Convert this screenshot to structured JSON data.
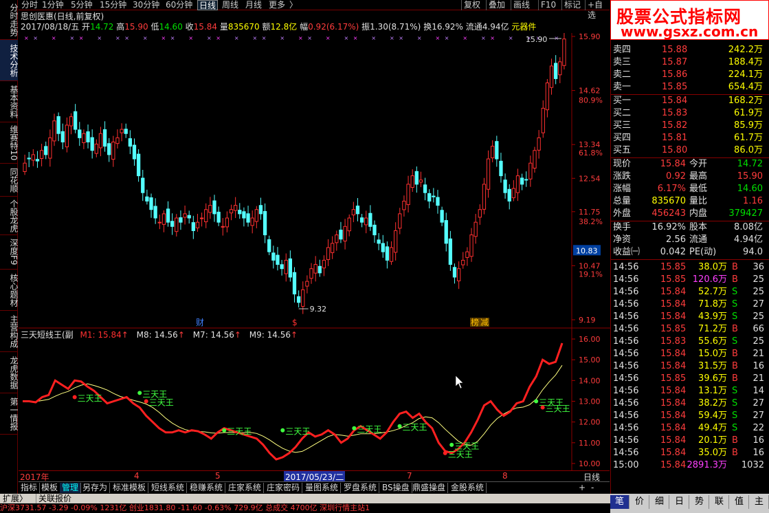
{
  "left_tabs": [
    "分时走势",
    "技术分析",
    "基本资料",
    "维赛特10",
    "同花顺",
    "个股龙虎",
    "深度F9",
    "核心题材",
    "主营构成",
    "龙虎数据",
    "第一情报"
  ],
  "period_bar": {
    "items": [
      "分时",
      "1分钟",
      "5分钟",
      "15分钟",
      "30分钟",
      "60分钟",
      "日线",
      "周线",
      "月线",
      "更多"
    ],
    "active": "日线",
    "more_arrow": "〉",
    "right_buttons": [
      "复权",
      "叠加",
      "画线",
      "F10",
      "标记",
      "+自选"
    ]
  },
  "watermark": {
    "title": "股票公式指标网",
    "url": "www.gsxz.com.cn"
  },
  "main_chart": {
    "stock_title": "思创医惠(日线,前复权)",
    "info": {
      "date": "2017/08/18/五",
      "open_label": "开",
      "open": "14.72",
      "high_label": "高",
      "high": "15.90",
      "low_label": "低",
      "low": "14.60",
      "close_label": "收",
      "close": "15.84",
      "vol_label": "量",
      "vol": "835670",
      "amt_label": "额",
      "amt": "12.8亿",
      "chg_label": "幅",
      "chg": "0.92(6.17%)",
      "amp_label": "振",
      "amp": "1.30(8.71%)",
      "turn_label": "换",
      "turn": "16.92%",
      "float_label": "流通",
      "float": "4.94亿",
      "tag": "元器件"
    },
    "price_labels": [
      "15.90",
      "14.62",
      "80.9%",
      "13.34",
      "61.8%",
      "12.54",
      "11.75",
      "38.2%",
      "10.47",
      "19.1%",
      "9.19"
    ],
    "current_price_box": "10.83",
    "annotations": {
      "high": "15.90",
      "low": "9.32"
    },
    "event_markers": [
      {
        "text": "财",
        "color": "#4080ff"
      },
      {
        "text": "$",
        "color": "#ff3030"
      },
      {
        "text": "榜",
        "color": "#ffc000"
      },
      {
        "text": "减",
        "color": "#ffc000"
      }
    ]
  },
  "indicator": {
    "name": "三天短线王(副",
    "lines": [
      {
        "label": "M1: 15.84",
        "color": "#ff3030"
      },
      {
        "label": "M8: 14.56",
        "color": "#ffffff"
      },
      {
        "label": "M7: 14.56",
        "color": "#ffffff"
      },
      {
        "label": "M9: 14.56",
        "color": "#ffffff"
      }
    ],
    "axis_labels": [
      "16.00",
      "15.00",
      "14.00",
      "13.00",
      "12.00",
      "11.00",
      "10.00"
    ],
    "signal_label": "三天王"
  },
  "time_axis": {
    "labels": [
      "2017年",
      "4",
      "5",
      "6",
      "7",
      "8"
    ],
    "highlight": "2017/05/23/二",
    "period": "日线"
  },
  "bottom_tabs": [
    "指标",
    "模板",
    "管理",
    "另存为",
    "标准模板",
    "短线系统",
    "稳赚系统",
    "庄家系统",
    "庄家密码",
    "量图系统",
    "罗盘系统",
    "BS操盘",
    "鼎盛操盘",
    "金股系统"
  ],
  "bottom_tabs_active": "管理",
  "expand_bar": {
    "items": [
      "扩展〉",
      "关联报价"
    ]
  },
  "right_tabs": [
    "笔",
    "价",
    "细",
    "日",
    "势",
    "联",
    "值",
    "主"
  ],
  "orderbook": {
    "asks": [
      {
        "label": "卖四",
        "price": "15.88",
        "vol": "242.2万"
      },
      {
        "label": "卖三",
        "price": "15.87",
        "vol": "188.4万"
      },
      {
        "label": "卖二",
        "price": "15.86",
        "vol": "224.1万"
      },
      {
        "label": "卖一",
        "price": "15.85",
        "vol": "654.4万"
      }
    ],
    "bids": [
      {
        "label": "买一",
        "price": "15.84",
        "vol": "168.2万"
      },
      {
        "label": "买二",
        "price": "15.83",
        "vol": "61.9万"
      },
      {
        "label": "买三",
        "price": "15.82",
        "vol": "85.9万"
      },
      {
        "label": "买四",
        "price": "15.81",
        "vol": "61.7万"
      },
      {
        "label": "买五",
        "price": "15.80",
        "vol": "86.0万"
      }
    ]
  },
  "quote": [
    [
      {
        "k": "现价",
        "v": "15.84",
        "c": "red"
      },
      {
        "k": "今开",
        "v": "14.72",
        "c": "grn"
      }
    ],
    [
      {
        "k": "涨跌",
        "v": "0.92",
        "c": "red"
      },
      {
        "k": "最高",
        "v": "15.90",
        "c": "red"
      }
    ],
    [
      {
        "k": "涨幅",
        "v": "6.17%",
        "c": "red"
      },
      {
        "k": "最低",
        "v": "14.60",
        "c": "grn"
      }
    ],
    [
      {
        "k": "总量",
        "v": "835670",
        "c": "yel"
      },
      {
        "k": "量比",
        "v": "1.16",
        "c": "red"
      }
    ],
    [
      {
        "k": "外盘",
        "v": "456243",
        "c": "red"
      },
      {
        "k": "内盘",
        "v": "379427",
        "c": "grn"
      }
    ]
  ],
  "fundamentals": [
    [
      {
        "k": "换手",
        "v": "16.92%"
      },
      {
        "k": "股本",
        "v": "8.08亿"
      }
    ],
    [
      {
        "k": "净资",
        "v": "2.56"
      },
      {
        "k": "流通",
        "v": "4.94亿"
      }
    ],
    [
      {
        "k": "收益㈠",
        "v": "0.042"
      },
      {
        "k": "PE(动)",
        "v": "94.0"
      }
    ]
  ],
  "ticks": [
    {
      "t": "14:56",
      "p": "15.85",
      "v": "38.0万",
      "bs": "B",
      "n": "36",
      "pc": "red",
      "vc": "yel"
    },
    {
      "t": "14:56",
      "p": "15.85",
      "v": "120.6万",
      "bs": "B",
      "n": "25",
      "pc": "red",
      "vc": "mag"
    },
    {
      "t": "14:56",
      "p": "15.84",
      "v": "52.7万",
      "bs": "S",
      "n": "25",
      "pc": "red",
      "vc": "yel"
    },
    {
      "t": "14:56",
      "p": "15.84",
      "v": "71.8万",
      "bs": "S",
      "n": "27",
      "pc": "red",
      "vc": "yel"
    },
    {
      "t": "14:56",
      "p": "15.84",
      "v": "43.9万",
      "bs": "S",
      "n": "25",
      "pc": "red",
      "vc": "yel"
    },
    {
      "t": "14:56",
      "p": "15.85",
      "v": "71.2万",
      "bs": "B",
      "n": "66",
      "pc": "red",
      "vc": "yel"
    },
    {
      "t": "14:56",
      "p": "15.83",
      "v": "55.6万",
      "bs": "S",
      "n": "25",
      "pc": "red",
      "vc": "yel"
    },
    {
      "t": "14:56",
      "p": "15.84",
      "v": "15.0万",
      "bs": "B",
      "n": "21",
      "pc": "red",
      "vc": "yel"
    },
    {
      "t": "14:56",
      "p": "15.84",
      "v": "31.5万",
      "bs": "B",
      "n": "16",
      "pc": "red",
      "vc": "yel"
    },
    {
      "t": "14:56",
      "p": "15.85",
      "v": "39.6万",
      "bs": "B",
      "n": "21",
      "pc": "red",
      "vc": "yel"
    },
    {
      "t": "14:56",
      "p": "15.84",
      "v": "13.1万",
      "bs": "S",
      "n": "14",
      "pc": "red",
      "vc": "yel"
    },
    {
      "t": "14:56",
      "p": "15.84",
      "v": "38.2万",
      "bs": "S",
      "n": "27",
      "pc": "red",
      "vc": "yel"
    },
    {
      "t": "14:56",
      "p": "15.84",
      "v": "59.4万",
      "bs": "S",
      "n": "27",
      "pc": "red",
      "vc": "yel"
    },
    {
      "t": "14:56",
      "p": "15.84",
      "v": "49.4万",
      "bs": "S",
      "n": "22",
      "pc": "red",
      "vc": "yel"
    },
    {
      "t": "14:56",
      "p": "15.84",
      "v": "20.1万",
      "bs": "B",
      "n": "16",
      "pc": "red",
      "vc": "yel"
    },
    {
      "t": "14:56",
      "p": "15.84",
      "v": "35.0万",
      "bs": "B",
      "n": "16",
      "pc": "red",
      "vc": "yel"
    },
    {
      "t": "15:00",
      "p": "15.84",
      "v": "2891.3万",
      "bs": "",
      "n": "1032",
      "pc": "red",
      "vc": "mag"
    }
  ],
  "status_bar": "沪深3731.57  -3.29  -0.09%  1231亿  创业1831.80  -11.60  -0.63%  729.9亿  总成交  4700亿  深圳行情主站1",
  "colors": {
    "up": "#ff3030",
    "down": "#54ffff",
    "grid": "#8b0000",
    "bg": "#000000",
    "accent_red": "#ff3c3c",
    "accent_green": "#00e000"
  }
}
